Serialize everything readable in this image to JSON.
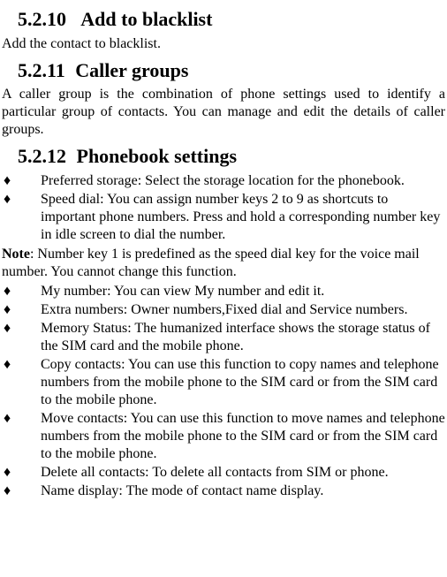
{
  "sections": {
    "s1": {
      "num": "5.2.10",
      "title": "Add to blacklist"
    },
    "s2": {
      "num": "5.2.11",
      "title": "Caller groups"
    },
    "s3": {
      "num": "5.2.12",
      "title": "Phonebook settings"
    }
  },
  "paras": {
    "p1": "Add the contact to blacklist.",
    "p2": "A caller group is the combination of phone settings used to identify a particular group of contacts.  You can manage and edit the details of caller groups."
  },
  "bullet_glyph": "♦",
  "list3a": [
    "Preferred storage: Select the storage location for the phonebook.",
    "Speed dial: You can assign number keys 2 to 9 as shortcuts to important phone numbers. Press and hold a corresponding number key in idle screen to dial the number."
  ],
  "note": {
    "label": "Note",
    "text": ": Number key 1 is predefined as the speed dial key for the voice mail number. You cannot change this function."
  },
  "list3b": [
    "My number: You can view My number and edit it.",
    "Extra numbers: Owner numbers,Fixed dial and Service numbers.",
    "Memory Status: The humanized interface shows the storage status of the SIM card and the mobile phone.",
    " Copy contacts: You can use this function to copy names and telephone numbers from the mobile phone to the SIM card or from the SIM card to the mobile phone.",
    "Move contacts: You can use this function to move names and telephone numbers from the mobile phone to the SIM card or from the SIM card to the mobile phone.",
    "Delete all contacts: To delete all contacts from SIM or phone.",
    "Name display: The mode of contact name display."
  ]
}
